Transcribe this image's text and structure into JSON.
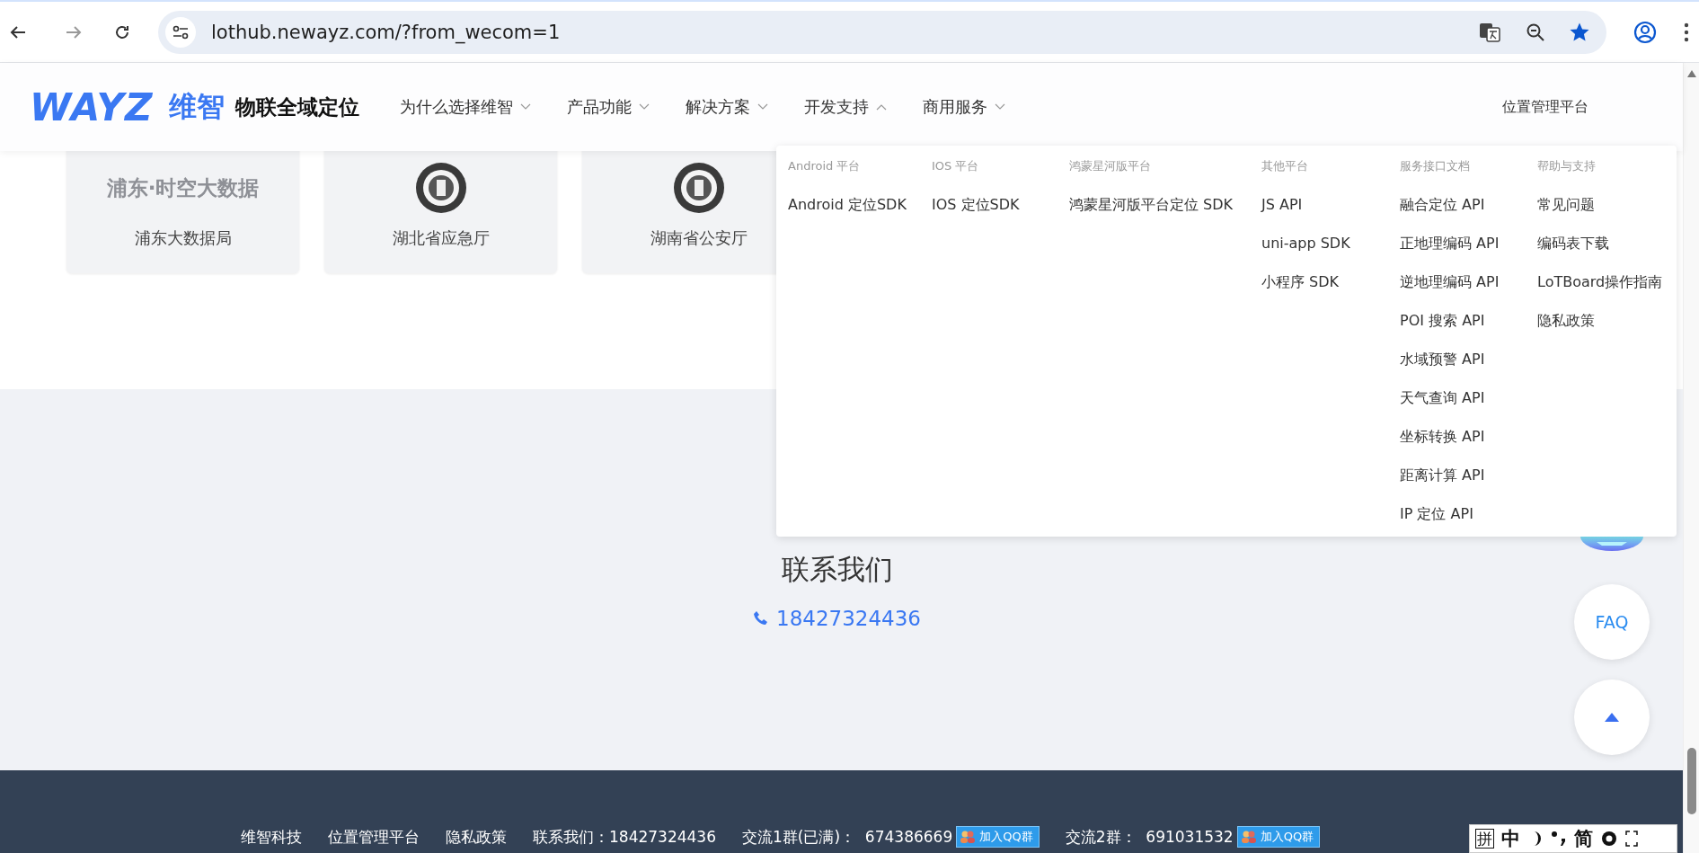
{
  "browser": {
    "url": "lothub.newayz.com/?from_wecom=1"
  },
  "header": {
    "logo": {
      "wordmark": "WAYZ",
      "brand": "维智",
      "slogan": "物联全域定位"
    },
    "nav": [
      {
        "label": "为什么选择维智",
        "expanded": false
      },
      {
        "label": "产品功能",
        "expanded": false
      },
      {
        "label": "解决方案",
        "expanded": false
      },
      {
        "label": "开发支持",
        "expanded": true
      },
      {
        "label": "商用服务",
        "expanded": false
      }
    ],
    "right_link": "位置管理平台"
  },
  "partners": [
    {
      "kind": "text-logo",
      "logo_text": "浦东·时空大数据",
      "name": "浦东大数据局"
    },
    {
      "kind": "emblem",
      "name": "湖北省应急厅"
    },
    {
      "kind": "emblem",
      "name": "湖南省公安厅"
    }
  ],
  "dropdown": {
    "columns": [
      {
        "title": "Android 平台",
        "items": [
          "Android 定位SDK"
        ]
      },
      {
        "title": "IOS 平台",
        "items": [
          "IOS 定位SDK"
        ]
      },
      {
        "title": "鸿蒙星河版平台",
        "items": [
          "鸿蒙星河版平台定位 SDK"
        ]
      },
      {
        "title": "其他平台",
        "items": [
          "JS API",
          "uni-app SDK",
          "小程序 SDK"
        ]
      },
      {
        "title": "服务接口文档",
        "items": [
          "融合定位 API",
          "正地理编码 API",
          "逆地理编码 API",
          "POI 搜索 API",
          "水域预警 API",
          "天气查询 API",
          "坐标转换 API",
          "距离计算 API",
          "IP 定位 API"
        ]
      },
      {
        "title": "帮助与支持",
        "items": [
          "常见问题",
          "编码表下载",
          "LoTBoard操作指南",
          "隐私政策"
        ]
      }
    ]
  },
  "contact": {
    "title": "联系我们",
    "phone": "18427324436"
  },
  "floating": {
    "faq": "FAQ"
  },
  "footer": {
    "items": [
      {
        "kind": "link",
        "text": "维智科技"
      },
      {
        "kind": "link",
        "text": "位置管理平台"
      },
      {
        "kind": "link",
        "text": "隐私政策"
      },
      {
        "kind": "text",
        "text": "联系我们：18427324436"
      },
      {
        "kind": "group",
        "text": "交流1群(已满)：  674386669",
        "button": "加入QQ群"
      },
      {
        "kind": "group",
        "text": "交流2群：  691031532",
        "button": "加入QQ群"
      }
    ]
  },
  "ime": {
    "mode": "拼",
    "lang": "中",
    "script": "简"
  }
}
